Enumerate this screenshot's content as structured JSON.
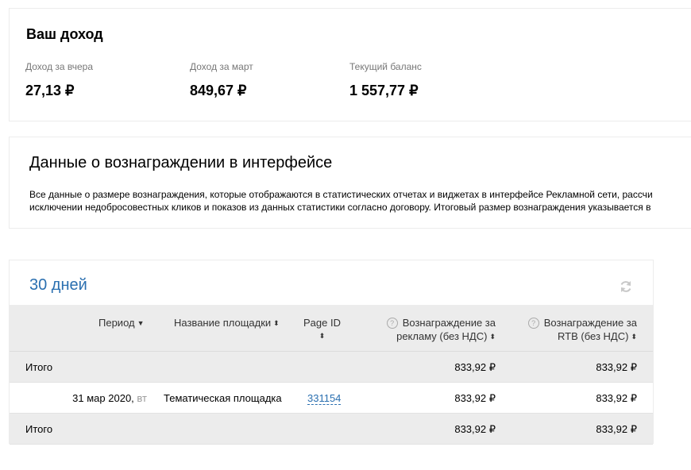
{
  "income": {
    "title": "Ваш доход",
    "stats": [
      {
        "label": "Доход за вчера",
        "value": "27,13 ₽"
      },
      {
        "label": "Доход за март",
        "value": "849,67 ₽"
      },
      {
        "label": "Текущий баланс",
        "value": "1 557,77 ₽"
      }
    ]
  },
  "info": {
    "title": "Данные о вознаграждении в интерфейсе",
    "line1": "Все данные о размере вознаграждения, которые отображаются в статистических отчетах и виджетах в интерфейсе Рекламной сети, рассчи",
    "line2": "исключении недобросовестных кликов и показов из данных статистики согласно договору. Итоговый размер вознаграждения указывается в"
  },
  "stats": {
    "period_title": "30 дней",
    "columns": {
      "period": "Период",
      "site": "Название площадки",
      "page_id": "Page ID",
      "ads_reward": "Вознаграждение за рекламу (без НДС)",
      "rtb_reward": "Вознаграждение за RTB (без НДС)"
    },
    "rows": [
      {
        "label": "Итого",
        "ads": "833,92 ₽",
        "rtb": "833,92 ₽"
      },
      {
        "date": "31 мар 2020,",
        "weekday": "вт",
        "site": "Тематическая площадка",
        "page_id": "331154",
        "ads": "833,92 ₽",
        "rtb": "833,92 ₽"
      },
      {
        "label": "Итого",
        "ads": "833,92 ₽",
        "rtb": "833,92 ₽"
      }
    ]
  }
}
